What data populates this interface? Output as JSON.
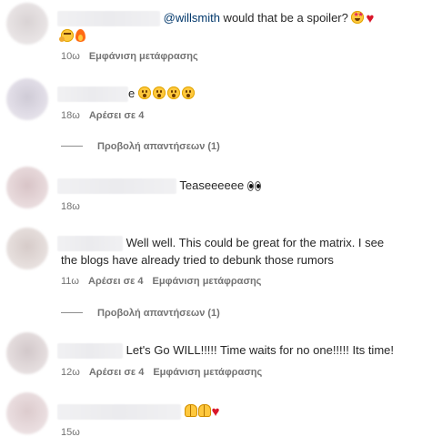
{
  "comments": [
    {
      "mention": "@willsmith",
      "text": " would that be a spoiler? ",
      "emojis_line1": [
        "star-struck",
        "heart"
      ],
      "emojis_line2": [
        "thinking",
        "fire"
      ],
      "time": "10ω",
      "translate": "Εμφάνιση μετάφρασης"
    },
    {
      "text": "e",
      "emojis": [
        "hushed",
        "hushed",
        "hushed",
        "hushed"
      ],
      "time": "18ω",
      "likes": "Αρέσει σε 4",
      "replies": "Προβολή απαντήσεων (1)"
    },
    {
      "text": "Teaseeeeee ",
      "emojis": [
        "eyes"
      ],
      "time": "18ω"
    },
    {
      "line1": "Well well. This could be great for the matrix. I see",
      "line2": "the blogs have already tried to debunk those rumors",
      "time": "11ω",
      "likes": "Αρέσει σε 4",
      "translate": "Εμφάνιση μετάφρασης",
      "replies": "Προβολή απαντήσεων (1)"
    },
    {
      "text": "Let's Go WILL!!!!! Time waits for no one!!!!! Its time!",
      "time": "12ω",
      "likes": "Αρέσει σε 4",
      "translate": "Εμφάνιση μετάφρασης"
    },
    {
      "emojis": [
        "raising-hands",
        "raising-hands",
        "heart"
      ],
      "time": "15ω"
    }
  ],
  "colors": {
    "text": "#262626",
    "meta": "#737373",
    "mention": "#00376b",
    "heart": "#d9162a"
  }
}
